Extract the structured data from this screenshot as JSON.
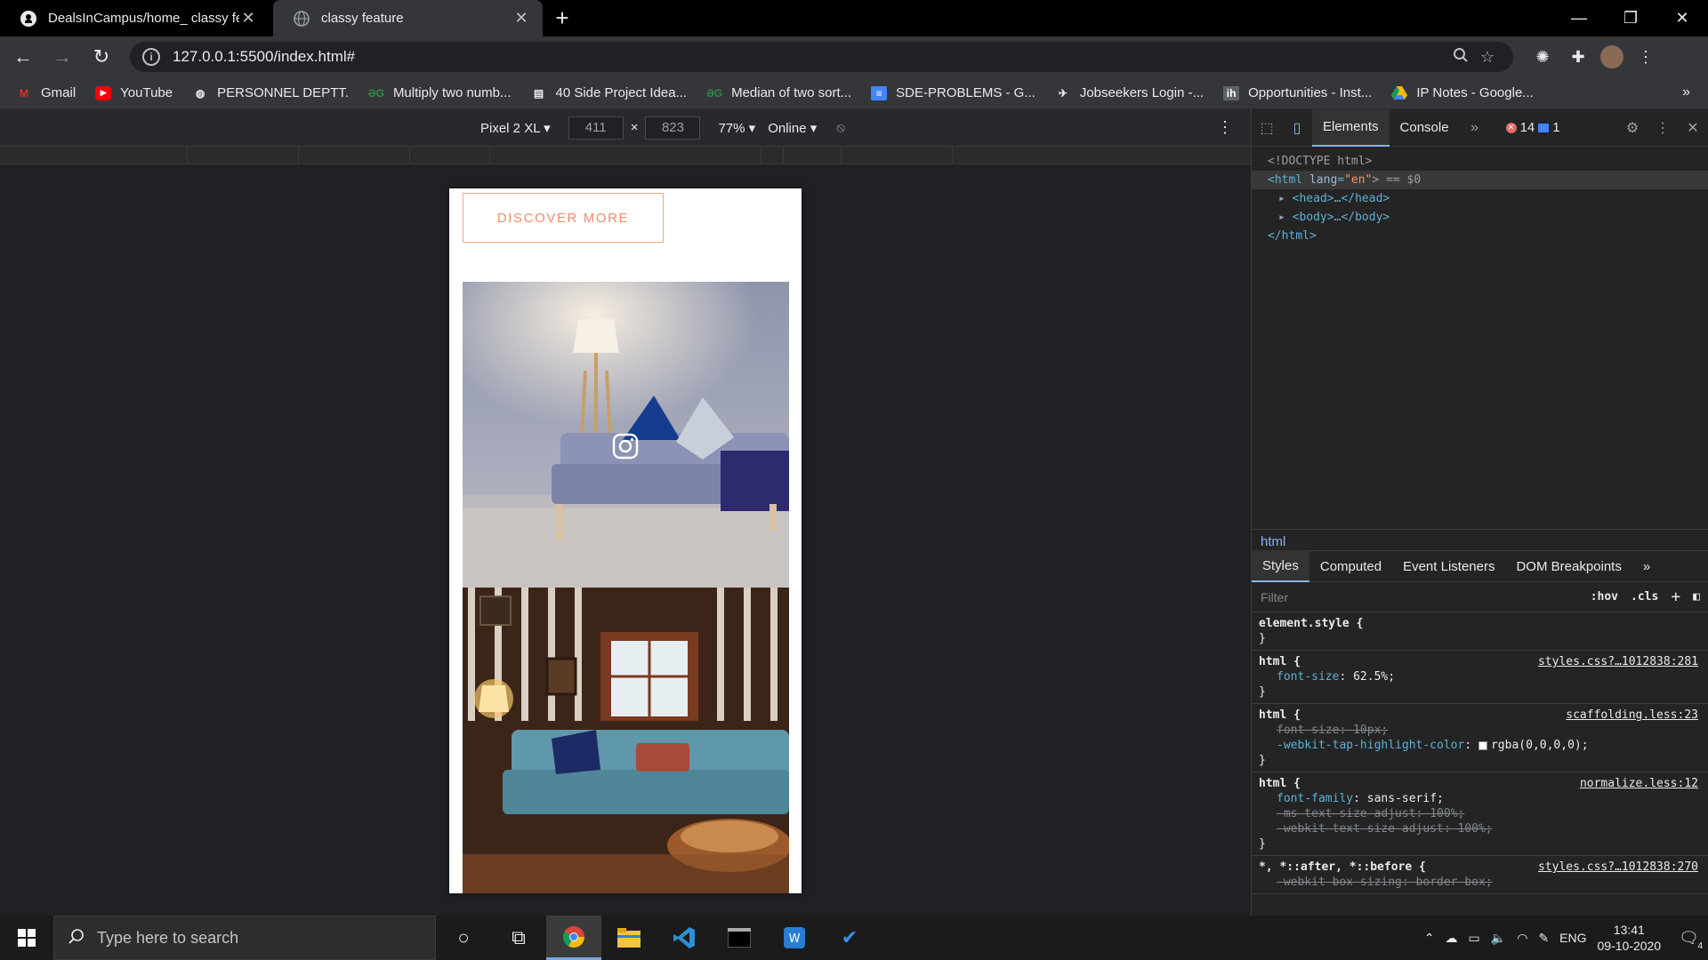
{
  "tabs": [
    {
      "title": "DealsInCampus/home_ classy fea",
      "icon": "github-icon",
      "active": false
    },
    {
      "title": "classy feature",
      "icon": "globe-icon",
      "active": true
    }
  ],
  "omnibox": {
    "url": "127.0.0.1:5500/index.html#"
  },
  "bookmarks": [
    {
      "label": "Gmail",
      "icon": "gmail-icon",
      "color": "#d93025"
    },
    {
      "label": "YouTube",
      "icon": "youtube-icon",
      "color": "#ff0000"
    },
    {
      "label": "PERSONNEL DEPTT.",
      "icon": "globe-icon",
      "color": "#e8eaed"
    },
    {
      "label": "Multiply two numb...",
      "icon": "gfg-icon",
      "color": "#2f8d46"
    },
    {
      "label": "40 Side Project Idea...",
      "icon": "book-icon",
      "color": "#e8eaed"
    },
    {
      "label": "Median of two sort...",
      "icon": "gfg-icon",
      "color": "#2f8d46"
    },
    {
      "label": "SDE-PROBLEMS - G...",
      "icon": "docs-icon",
      "color": "#4285f4"
    },
    {
      "label": "Jobseekers Login -...",
      "icon": "runner-icon",
      "color": "#e8eaed"
    },
    {
      "label": "Opportunities - Inst...",
      "icon": "ih-icon",
      "color": "#e8eaed"
    },
    {
      "label": "IP Notes - Google...",
      "icon": "drive-icon",
      "color": "#fbbc04"
    }
  ],
  "device_toolbar": {
    "device": "Pixel 2 XL",
    "width": "411",
    "height": "823",
    "zoom": "77%",
    "network": "Online"
  },
  "page": {
    "discover_label": "DISCOVER MORE"
  },
  "devtools": {
    "tabs": [
      "Elements",
      "Console"
    ],
    "errors": "14",
    "messages": "1",
    "dom": {
      "doctype": "<!DOCTYPE html>",
      "html_open": "<html",
      "lang_attr": "lang",
      "lang_val": "\"en\"",
      "html_suffix": "> == $0",
      "head": "<head>…</head>",
      "body": "<body>…</body>",
      "html_close": "</html>"
    },
    "breadcrumb": "html",
    "style_tabs": [
      "Styles",
      "Computed",
      "Event Listeners",
      "DOM Breakpoints"
    ],
    "filter_placeholder": "Filter",
    "hov": ":hov",
    "cls": ".cls",
    "rules": [
      {
        "selector": "element.style {",
        "source": "",
        "decls": []
      },
      {
        "selector": "html {",
        "source": "styles.css?…1012838:281",
        "decls": [
          {
            "name": "font-size",
            "value": "62.5%;",
            "struck": false
          }
        ]
      },
      {
        "selector": "html {",
        "source": "scaffolding.less:23",
        "decls": [
          {
            "name": "font-size",
            "value": "10px;",
            "struck": true
          },
          {
            "name": "-webkit-tap-highlight-color",
            "value": "rgba(0,0,0,0);",
            "struck": false
          }
        ]
      },
      {
        "selector": "html {",
        "source": "normalize.less:12",
        "decls": [
          {
            "name": "font-family",
            "value": "sans-serif;",
            "struck": false
          },
          {
            "name": "-ms-text-size-adjust",
            "value": "100%;",
            "struck": true
          },
          {
            "name": "-webkit-text-size-adjust",
            "value": "100%;",
            "struck": true
          }
        ]
      },
      {
        "selector": "*, *::after, *::before {",
        "source": "styles.css?…1012838:270",
        "decls": [
          {
            "name": "-webkit-box-sizing",
            "value": "border-box;",
            "struck": true
          }
        ]
      }
    ]
  },
  "taskbar": {
    "search_placeholder": "Type here to search",
    "lang": "ENG",
    "time": "13:41",
    "date": "09-10-2020",
    "notifications": "4"
  }
}
